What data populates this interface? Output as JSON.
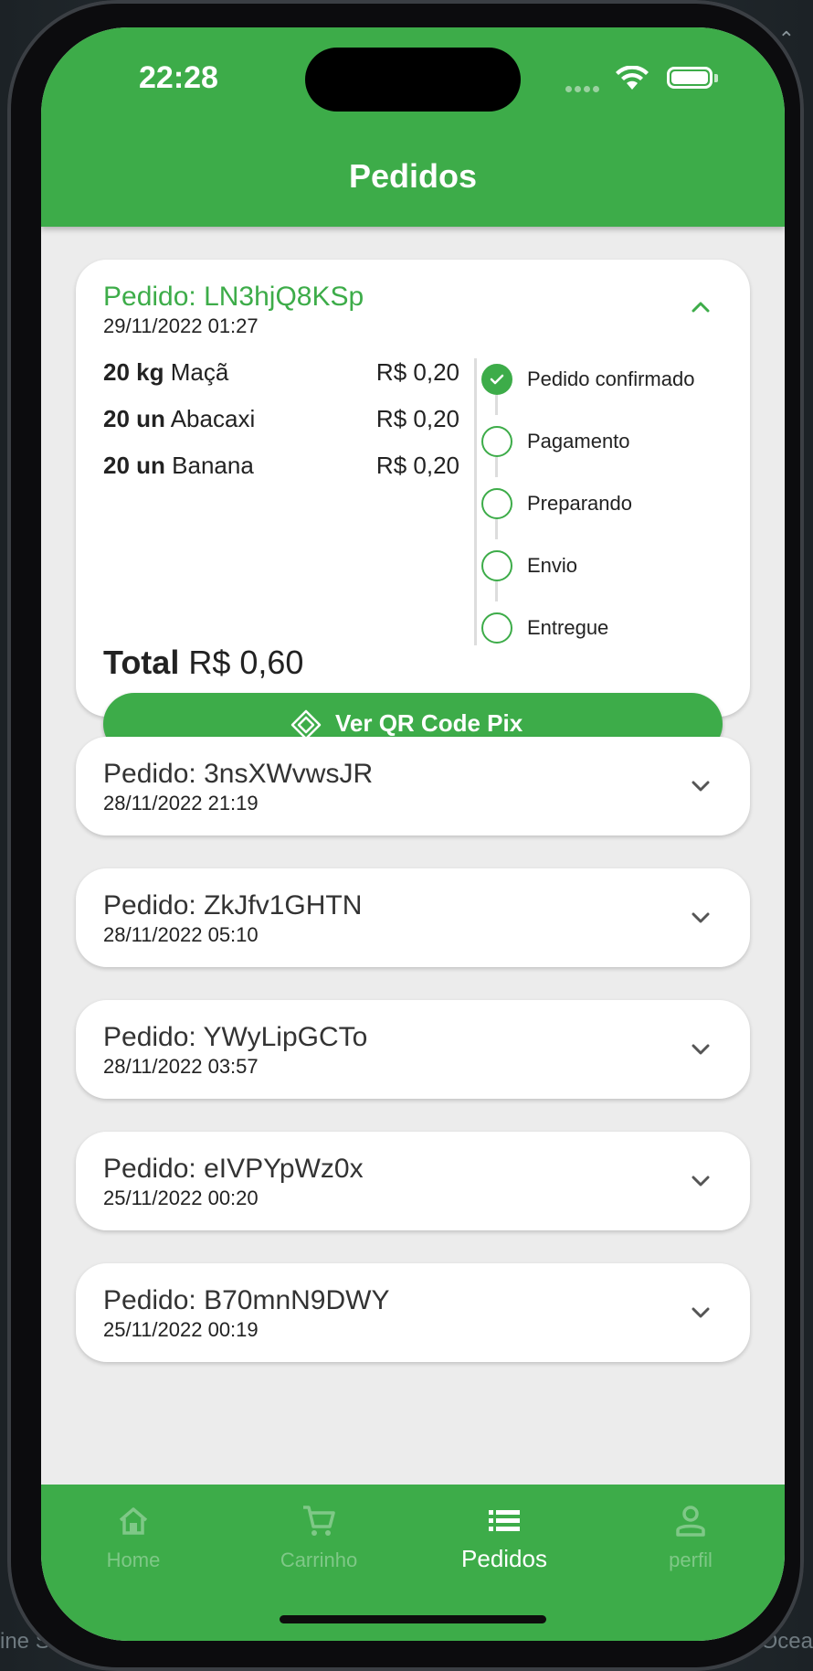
{
  "status_bar": {
    "time": "22:28"
  },
  "header": {
    "title": "Pedidos"
  },
  "expanded_order": {
    "id_label": "Pedido: LN3hjQ8KSp",
    "date": "29/11/2022 01:27",
    "items": [
      {
        "qty": "20 kg",
        "name": "Maçã",
        "price": "R$ 0,20"
      },
      {
        "qty": "20 un",
        "name": "Abacaxi",
        "price": "R$ 0,20"
      },
      {
        "qty": "20 un",
        "name": "Banana",
        "price": "R$ 0,20"
      }
    ],
    "steps": [
      {
        "label": "Pedido confirmado",
        "done": true
      },
      {
        "label": "Pagamento",
        "done": false
      },
      {
        "label": "Preparando",
        "done": false
      },
      {
        "label": "Envio",
        "done": false
      },
      {
        "label": "Entregue",
        "done": false
      }
    ],
    "total_label": "Total",
    "total_value": "R$ 0,60",
    "qr_button": "Ver QR Code Pix"
  },
  "orders": [
    {
      "id_label": "Pedido: 3nsXWvwsJR",
      "date": "28/11/2022 21:19"
    },
    {
      "id_label": "Pedido: ZkJfv1GHTN",
      "date": "28/11/2022 05:10"
    },
    {
      "id_label": "Pedido: YWyLipGCTo",
      "date": "28/11/2022 03:57"
    },
    {
      "id_label": "Pedido: eIVPYpWz0x",
      "date": "25/11/2022 00:20"
    },
    {
      "id_label": "Pedido: B70mnN9DWY",
      "date": "25/11/2022 00:19"
    }
  ],
  "bottom_nav": [
    {
      "label": "Home",
      "icon": "home-icon",
      "active": false
    },
    {
      "label": "Carrinho",
      "icon": "cart-icon",
      "active": false
    },
    {
      "label": "Pedidos",
      "icon": "list-icon",
      "active": true
    },
    {
      "label": "perfil",
      "icon": "person-icon",
      "active": false
    }
  ],
  "background": {
    "left_text": "ine St",
    "right_text": "Ocea"
  },
  "colors": {
    "primary": "#3dac49",
    "background": "#ececec",
    "card": "#ffffff"
  }
}
